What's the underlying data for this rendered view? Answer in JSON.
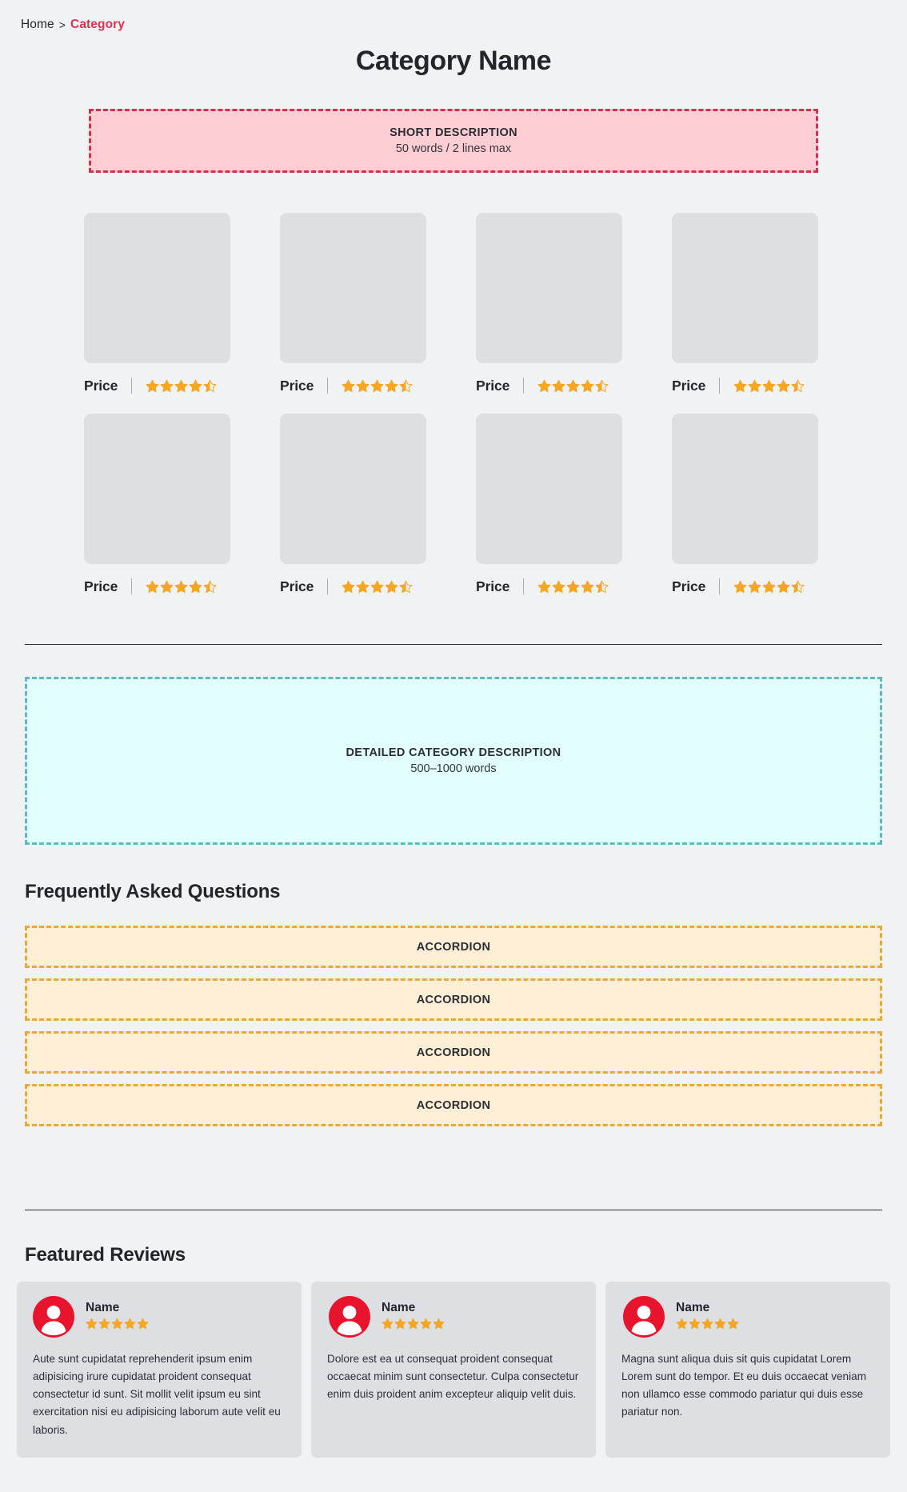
{
  "breadcrumb": {
    "home_label": "Home",
    "separator": ">",
    "current_label": "Category"
  },
  "page_title": "Category Name",
  "short_description_block": {
    "title": "SHORT DESCRIPTION",
    "subtitle": "50 words / 2 lines max",
    "fill_color": "#ffcdd4",
    "border_color": "#d2314f"
  },
  "product_grid": {
    "rating_value": 4.5,
    "items": [
      {
        "price_label": "Price",
        "rating": 4.5
      },
      {
        "price_label": "Price",
        "rating": 4.5
      },
      {
        "price_label": "Price",
        "rating": 4.5
      },
      {
        "price_label": "Price",
        "rating": 4.5
      },
      {
        "price_label": "Price",
        "rating": 4.5
      },
      {
        "price_label": "Price",
        "rating": 4.5
      },
      {
        "price_label": "Price",
        "rating": 4.5
      },
      {
        "price_label": "Price",
        "rating": 4.5
      }
    ]
  },
  "detailed_description_block": {
    "title": "DETAILED CATEGORY DESCRIPTION",
    "subtitle": "500–1000 words",
    "fill_color": "#e2fdfd",
    "border_color": "#61b9bb"
  },
  "faq": {
    "heading": "Frequently Asked Questions",
    "accordions": [
      {
        "label": "ACCORDION"
      },
      {
        "label": "ACCORDION"
      },
      {
        "label": "ACCORDION"
      },
      {
        "label": "ACCORDION"
      }
    ],
    "fill_color": "#fdeed6",
    "border_color": "#e8a93a"
  },
  "featured_reviews": {
    "heading": "Featured Reviews",
    "avatar_color": "#e8142d",
    "star_color": "#f5a623",
    "cards": [
      {
        "name": "Name",
        "rating": 5,
        "text": "Aute sunt cupidatat reprehenderit ipsum enim adipisicing irure cupidatat proident consequat consectetur id sunt. Sit mollit velit ipsum eu sint exercitation nisi eu adipisicing laborum aute velit eu laboris."
      },
      {
        "name": "Name",
        "rating": 5,
        "text": "Dolore est ea ut consequat proident consequat occaecat minim sunt consectetur. Culpa consectetur enim duis proident anim excepteur aliquip velit duis."
      },
      {
        "name": "Name",
        "rating": 5,
        "text": "Magna sunt aliqua duis sit quis cupidatat Lorem Lorem sunt do tempor. Et eu duis occaecat veniam non ullamco esse commodo pariatur qui duis esse pariatur non."
      }
    ]
  }
}
